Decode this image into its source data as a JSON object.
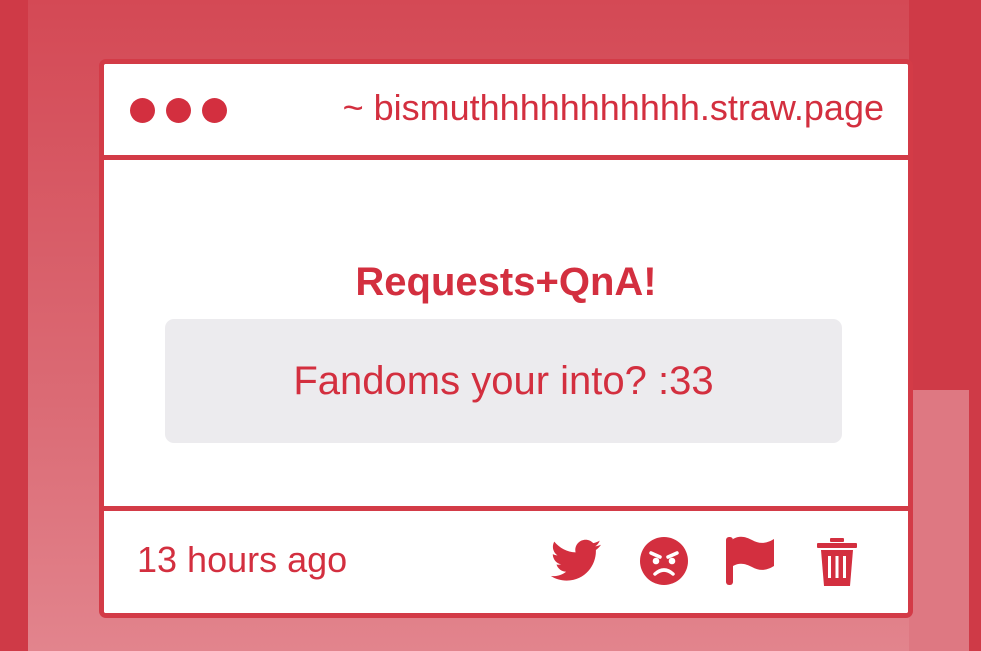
{
  "window": {
    "address": "~ bismuthhhhhhhhhhh.straw.page",
    "window_controls": [
      {
        "icon": "window-dot-icon",
        "color": "#d32f3f"
      },
      {
        "icon": "window-dot-icon",
        "color": "#d32f3f"
      },
      {
        "icon": "window-dot-icon",
        "color": "#d32f3f"
      }
    ]
  },
  "post": {
    "title": "Requests+QnA!",
    "question": "Fandoms your into? :33",
    "timestamp": "13 hours ago"
  },
  "actions": [
    {
      "name": "share-twitter",
      "icon": "twitter-icon"
    },
    {
      "name": "react-angry",
      "icon": "angry-face-icon"
    },
    {
      "name": "report",
      "icon": "flag-icon"
    },
    {
      "name": "delete",
      "icon": "trash-icon"
    }
  ],
  "colors": {
    "accent": "#d32f3f",
    "outer_background": "#cf3a47",
    "question_background": "#ecebee",
    "window_background": "#ffffff"
  }
}
